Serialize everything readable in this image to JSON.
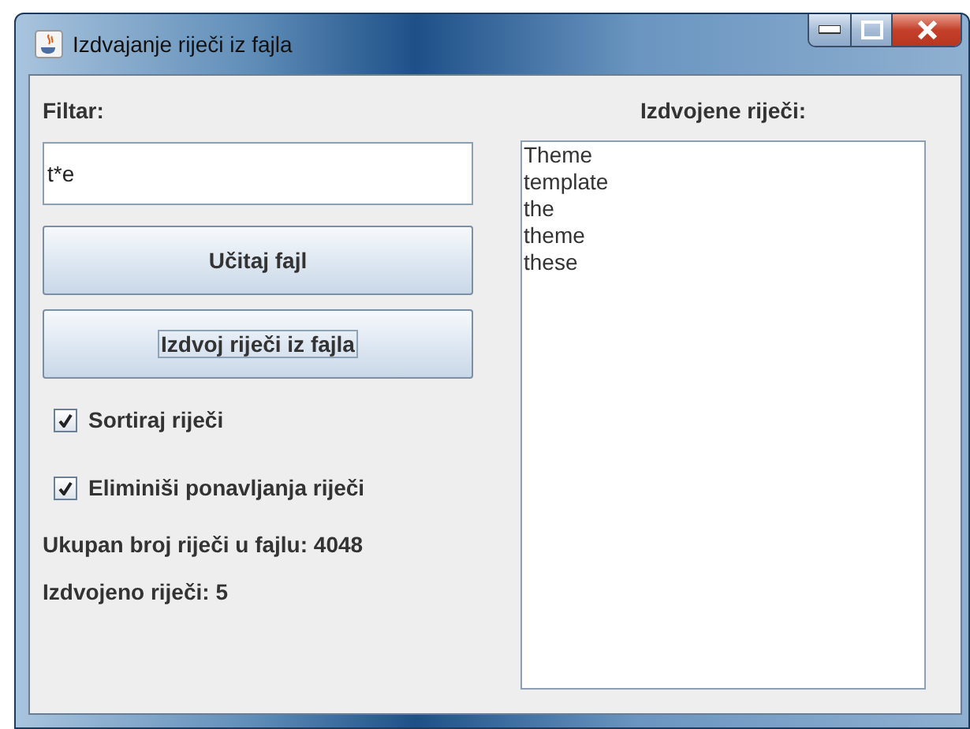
{
  "window": {
    "title": "Izdvajanje riječi iz fajla"
  },
  "filter": {
    "label": "Filtar:",
    "value": "t*e"
  },
  "buttons": [
    {
      "label": "Učitaj fajl",
      "focused": false
    },
    {
      "label": "Izdvoj riječi iz fajla",
      "focused": true
    }
  ],
  "options": [
    {
      "label": "Sortiraj riječi",
      "checked": true
    },
    {
      "label": "Eliminiši ponavljanja riječi",
      "checked": true
    }
  ],
  "stats": [
    "Ukupan broj riječi u fajlu: 4048",
    "Izdvojeno riječi: 5"
  ],
  "result": {
    "label": "Izdvojene riječi:",
    "words": [
      "Theme",
      "template",
      "the",
      "theme",
      "these"
    ]
  }
}
